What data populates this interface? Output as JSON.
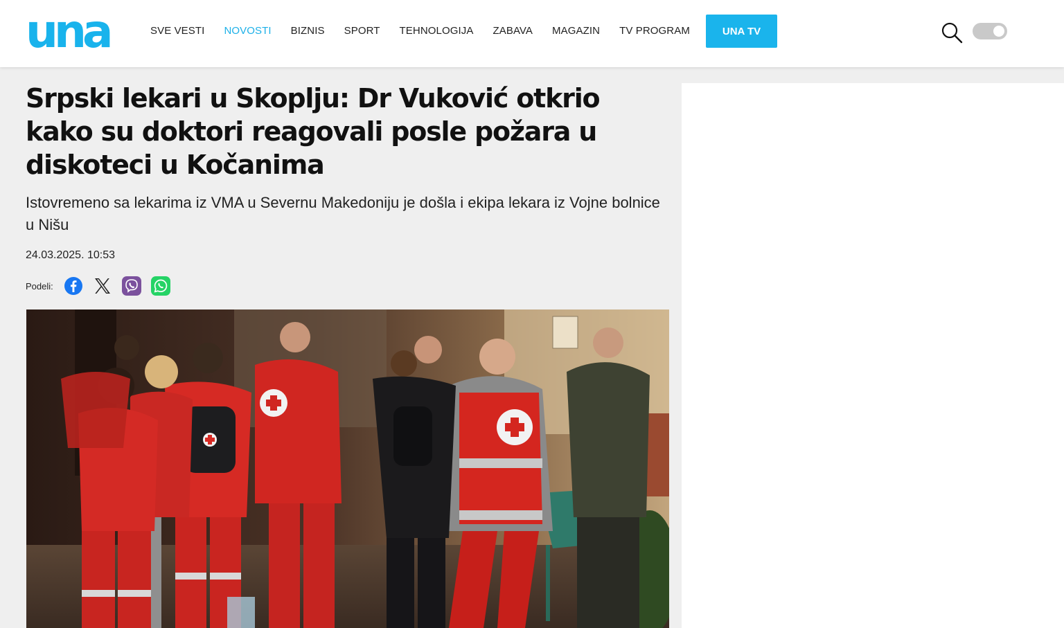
{
  "header": {
    "logo_text": "una",
    "nav": [
      "SVE VESTI",
      "NOVOSTI",
      "BIZNIS",
      "SPORT",
      "TEHNOLOGIJA",
      "ZABAVA",
      "MAGAZIN",
      "TV PROGRAM"
    ],
    "active_nav": "NOVOSTI",
    "cta_label": "UNA TV",
    "icons": [
      "search-icon",
      "theme-toggle"
    ]
  },
  "article": {
    "title": "Srpski lekari u Skoplju: Dr Vuković otkrio kako su doktori reagovali posle požara u diskoteci u Kočanima",
    "lead": "Istovremeno sa lekarima iz VMA u Severnu Makedoniju je došla i ekipa lekara iz Vojne bolnice u Nišu",
    "date": "24.03.2025. 10:53",
    "share_label": "Podeli:",
    "share_icons": [
      "facebook-icon",
      "x-icon",
      "viber-icon",
      "whatsapp-icon"
    ]
  },
  "colors": {
    "accent": "#1cb0e8",
    "cta": "#1ab4ec",
    "facebook": "#1877f2",
    "viber": "#7b519d",
    "whatsapp": "#25d366"
  }
}
